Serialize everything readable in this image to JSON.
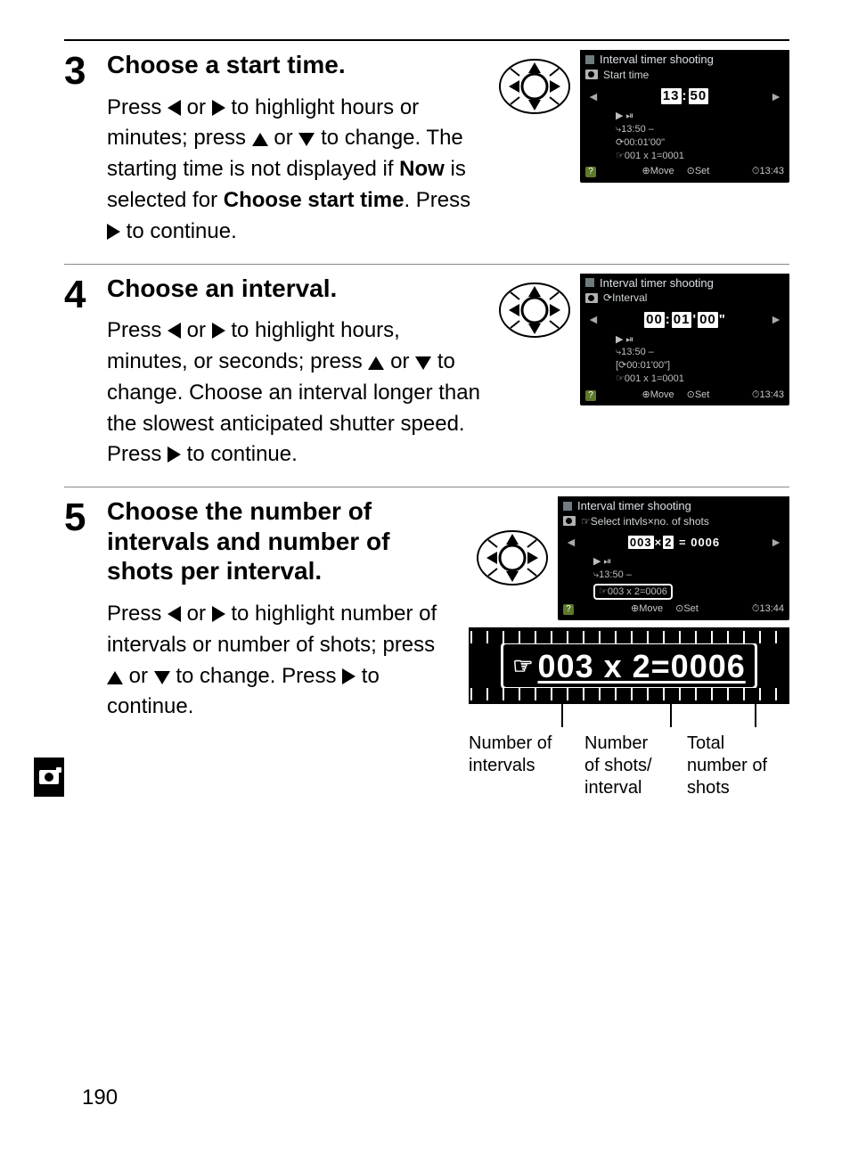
{
  "page_number": "190",
  "steps": {
    "s3": {
      "num": "3",
      "title": "Choose a start time.",
      "desc_parts": [
        "Press ",
        " or ",
        " to highlight hours or minutes; press ",
        " or ",
        " to change.  The starting time is not displayed if ",
        "Now",
        " is selected for ",
        "Choose start time",
        ".  Press ",
        " to continue."
      ]
    },
    "s4": {
      "num": "4",
      "title": "Choose an interval.",
      "desc_parts": [
        "Press ",
        " or ",
        " to highlight hours, minutes, or seconds; press ",
        " or ",
        " to change.  Choose an interval longer than the slowest anticipated shutter speed.  Press ",
        " to continue."
      ]
    },
    "s5": {
      "num": "5",
      "title": "Choose the number of intervals and number of shots per interval.",
      "desc_parts": [
        "Press ",
        " or ",
        " to highlight number of intervals or number of shots; press ",
        " or ",
        " to change.  Press ",
        " to continue."
      ]
    }
  },
  "lcd": {
    "s3": {
      "title": "Interval timer shooting",
      "subtitle": "Start time",
      "value_h": "13",
      "value_sep": ":",
      "value_m": "50",
      "info1": "▶ ⏯",
      "info2": "⤷13:50 –",
      "info3": "⟳00:01'00\"",
      "info4": "☞001 x 1=0001",
      "foot_move": "Move",
      "foot_set": "Set",
      "clock": "13:43"
    },
    "s4": {
      "title": "Interval timer shooting",
      "subtitle": "Interval",
      "value_h": "00",
      "sep1": ":",
      "value_m": "01",
      "sep2": "'",
      "value_s": "00",
      "sep3": "\"",
      "info1": "▶ ⏯",
      "info2": "⤷13:50 –",
      "info3": "[⟳00:01'00\"]",
      "info4": "☞001 x 1=0001",
      "foot_move": "Move",
      "foot_set": "Set",
      "clock": "13:43"
    },
    "s5": {
      "title": "Interval timer shooting",
      "subtitle": "Select intvls×no. of shots",
      "val_intvls": "003",
      "x": "×",
      "val_shots": "2",
      "eq": " = ",
      "val_total": "0006",
      "info1": "▶ ⏯",
      "info2": "⤷13:50 –",
      "info_hl": "☞003 x 2=0006",
      "foot_move": "Move",
      "foot_set": "Set",
      "clock": "13:44"
    }
  },
  "zoom": {
    "text": "003 x 2=0006"
  },
  "callouts": {
    "c1a": "Number of",
    "c1b": "intervals",
    "c2a": "Number",
    "c2b": "of shots/",
    "c2c": "interval",
    "c3a": "Total",
    "c3b": "number of",
    "c3c": "shots"
  }
}
